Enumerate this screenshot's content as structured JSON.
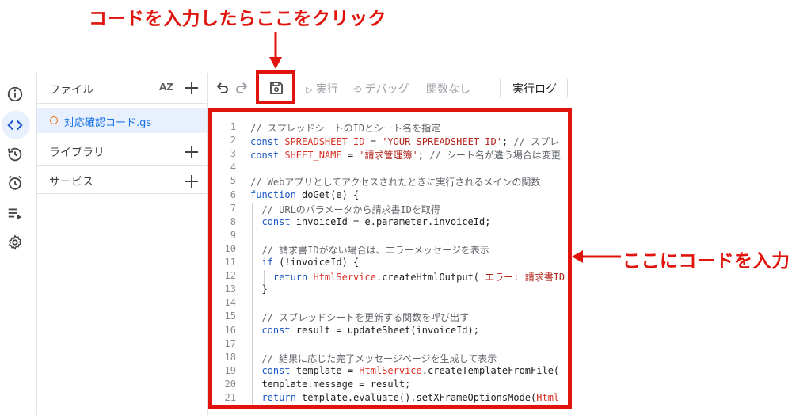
{
  "annotations": {
    "top": "コードを入力したらここをクリック",
    "right": "ここにコードを入力"
  },
  "colors": {
    "annotation_red": "#e0140c",
    "active_blue": "#1a73e8",
    "selected_bg": "#e8f0fe",
    "file_dot_orange": "#e8710a"
  },
  "rail": {
    "icons": [
      "info-icon",
      "code-icon",
      "history-icon",
      "alarm-icon",
      "executions-icon",
      "settings-icon"
    ]
  },
  "sidebar": {
    "files_label": "ファイル",
    "sort_label": "AZ",
    "active_file": "対応確認コード.gs",
    "libraries_label": "ライブラリ",
    "services_label": "サービス"
  },
  "toolbar": {
    "run_label": "実行",
    "debug_label": "デバッグ",
    "function_label": "関数なし",
    "log_label": "実行ログ"
  },
  "editor": {
    "lines": [
      {
        "n": "1",
        "parts": [
          {
            "t": "// スプレッドシートのIDとシート名を指定",
            "c": "cm"
          }
        ]
      },
      {
        "n": "2",
        "parts": [
          {
            "t": "const ",
            "c": "kw"
          },
          {
            "t": "SPREADSHEET_ID",
            "c": "cls"
          },
          {
            "t": " = ",
            "c": ""
          },
          {
            "t": "'YOUR_SPREADSHEET_ID'",
            "c": "str"
          },
          {
            "t": "; ",
            "c": ""
          },
          {
            "t": "// スプレ",
            "c": "cm"
          }
        ]
      },
      {
        "n": "3",
        "parts": [
          {
            "t": "const ",
            "c": "kw"
          },
          {
            "t": "SHEET_NAME",
            "c": "cls"
          },
          {
            "t": " = ",
            "c": ""
          },
          {
            "t": "'請求管理簿'",
            "c": "str"
          },
          {
            "t": "; ",
            "c": ""
          },
          {
            "t": "// シート名が違う場合は変更",
            "c": "cm"
          }
        ]
      },
      {
        "n": "4",
        "parts": []
      },
      {
        "n": "5",
        "parts": [
          {
            "t": "// Webアプリとしてアクセスされたときに実行されるメインの関数",
            "c": "cm"
          }
        ]
      },
      {
        "n": "6",
        "parts": [
          {
            "t": "function ",
            "c": "kw"
          },
          {
            "t": "doGet(e) {",
            "c": ""
          }
        ]
      },
      {
        "n": "7",
        "parts": [
          {
            "t": "  // URLのパラメータから請求書IDを取得",
            "c": "cm"
          }
        ]
      },
      {
        "n": "8",
        "parts": [
          {
            "t": "  const ",
            "c": "kw"
          },
          {
            "t": "invoiceId = e.parameter.invoiceId;",
            "c": ""
          }
        ]
      },
      {
        "n": "9",
        "parts": []
      },
      {
        "n": "10",
        "parts": [
          {
            "t": "  // 請求書IDがない場合は、エラーメッセージを表示",
            "c": "cm"
          }
        ]
      },
      {
        "n": "11",
        "parts": [
          {
            "t": "  if ",
            "c": "kw"
          },
          {
            "t": "(!invoiceId) {",
            "c": ""
          }
        ]
      },
      {
        "n": "12",
        "parts": [
          {
            "t": "    return ",
            "c": "kw"
          },
          {
            "t": "HtmlService",
            "c": "cls"
          },
          {
            "t": ".createHtmlOutput(",
            "c": ""
          },
          {
            "t": "'エラー: 請求書ID",
            "c": "str"
          }
        ]
      },
      {
        "n": "13",
        "parts": [
          {
            "t": "  }",
            "c": ""
          }
        ]
      },
      {
        "n": "14",
        "parts": []
      },
      {
        "n": "15",
        "parts": [
          {
            "t": "  // スプレッドシートを更新する関数を呼び出す",
            "c": "cm"
          }
        ]
      },
      {
        "n": "16",
        "parts": [
          {
            "t": "  const ",
            "c": "kw"
          },
          {
            "t": "result = updateSheet(invoiceId);",
            "c": ""
          }
        ]
      },
      {
        "n": "17",
        "parts": []
      },
      {
        "n": "18",
        "parts": [
          {
            "t": "  // 結果に応じた完了メッセージページを生成して表示",
            "c": "cm"
          }
        ]
      },
      {
        "n": "19",
        "parts": [
          {
            "t": "  const ",
            "c": "kw"
          },
          {
            "t": "template = ",
            "c": ""
          },
          {
            "t": "HtmlService",
            "c": "cls"
          },
          {
            "t": ".createTemplateFromFile(",
            "c": ""
          }
        ]
      },
      {
        "n": "20",
        "parts": [
          {
            "t": "  template.message = result;",
            "c": ""
          }
        ]
      },
      {
        "n": "21",
        "parts": [
          {
            "t": "  return ",
            "c": "kw"
          },
          {
            "t": "template.evaluate().setXFrameOptionsMode(",
            "c": ""
          },
          {
            "t": "Html",
            "c": "cls"
          }
        ]
      }
    ]
  }
}
